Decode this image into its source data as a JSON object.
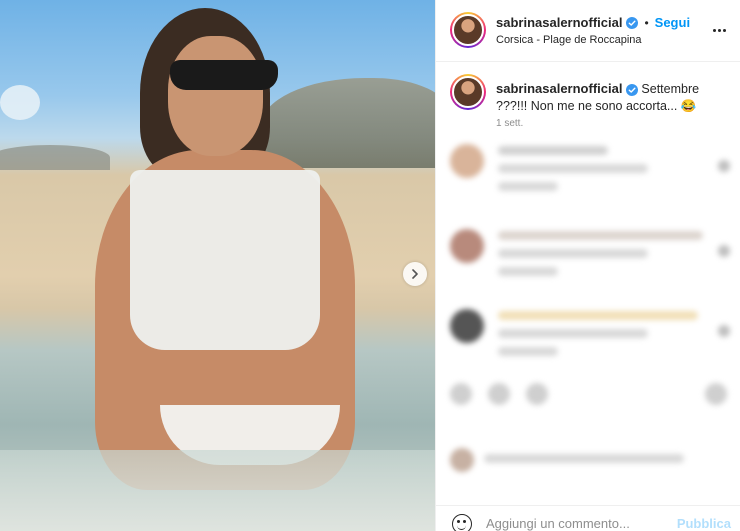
{
  "post": {
    "username": "sabrinasalernofficial",
    "follow_label": "Segui",
    "separator": "•",
    "location": "Corsica - Plage de Roccapina"
  },
  "caption": {
    "username": "sabrinasalernofficial",
    "text": "Settembre ???!!! Non me ne sono accorta... 😂",
    "time": "1 sett."
  },
  "comment_box": {
    "placeholder": "Aggiungi un commento...",
    "publish_label": "Pubblica"
  },
  "colors": {
    "accent": "#0095f6",
    "publish_disabled": "#b2dffc",
    "verified": "#3897f0"
  },
  "icons": {
    "next": "chevron-right-icon",
    "more": "more-horizontal-icon",
    "verified": "verified-badge-icon",
    "emoji": "emoji-icon"
  }
}
